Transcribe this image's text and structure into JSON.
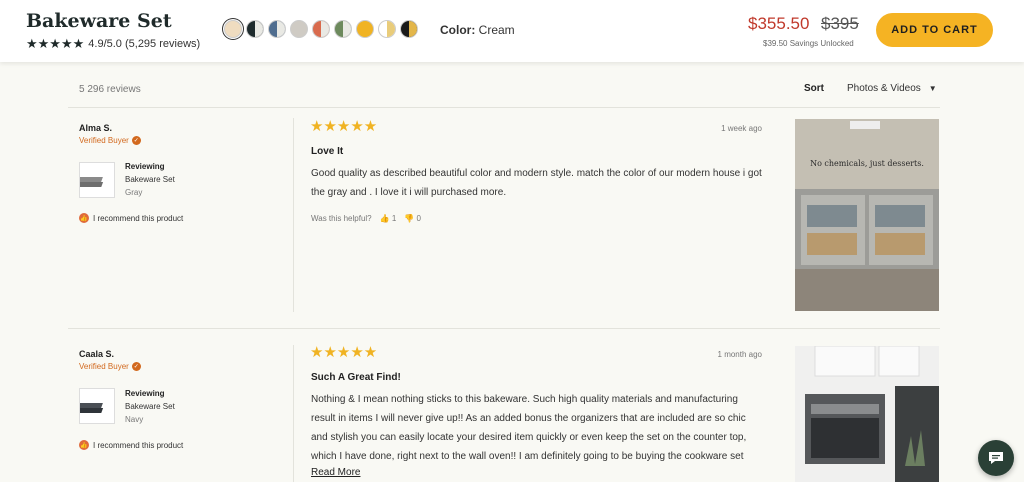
{
  "header": {
    "title": "Bakeware Set",
    "rating_text": "4.9/5.0 (5,295 reviews)",
    "stars": "★★★★★",
    "color_label": "Color:",
    "color_value": "Cream",
    "price_now": "$355.50",
    "price_was": "$395",
    "savings": "$39.50 Savings Unlocked",
    "cart_label": "ADD TO CART",
    "swatches": [
      {
        "name": "Cream",
        "color": "#efdcc0",
        "half": ""
      },
      {
        "name": "Navy-Black",
        "color": "#1e2b2d",
        "half": "#e9e9e4"
      },
      {
        "name": "Blue",
        "color": "#4f6d8f",
        "half": "#e9e9e4"
      },
      {
        "name": "Gray",
        "color": "#cfcbc4",
        "half": ""
      },
      {
        "name": "Terracotta",
        "color": "#d96b4e",
        "half": "#e9e9e4"
      },
      {
        "name": "Sage",
        "color": "#6d8a5d",
        "half": "#e9e9e4"
      },
      {
        "name": "Mustard",
        "color": "#f0b323",
        "half": ""
      },
      {
        "name": "White-Gold",
        "color": "#ffffff",
        "half": "#e9cc7a"
      },
      {
        "name": "Black-Gold",
        "color": "#1a1a1a",
        "half": "#e3b64a"
      }
    ]
  },
  "toolbar": {
    "review_count": "5 296 reviews",
    "sort_label": "Sort",
    "sort_value": "Photos & Videos"
  },
  "reviews": [
    {
      "name": "Alma S.",
      "verified": "Verified Buyer",
      "reviewing_head": "Reviewing",
      "product": "Bakeware Set",
      "variant": "Gray",
      "recommend": "I recommend this product",
      "stars": "★★★★★",
      "date": "1 week ago",
      "title": "Love It",
      "body": "Good quality as described beautiful color and modern style. match the color of our modern house i got the gray and . I love it i will purchased more.",
      "helpful_label": "Was this helpful?",
      "up": "1",
      "down": "0",
      "photo_caption": "No chemicals, just desserts."
    },
    {
      "name": "Caala S.",
      "verified": "Verified Buyer",
      "reviewing_head": "Reviewing",
      "product": "Bakeware Set",
      "variant": "Navy",
      "recommend": "I recommend this product",
      "stars": "★★★★★",
      "date": "1 month ago",
      "title": "Such A Great Find!",
      "body": "Nothing & I mean nothing sticks to this bakeware. Such high quality materials and manufacturing result in items I will never give up!! As an added bonus the organizers that are included are so chic and stylish you can easily locate your desired item quickly or even keep the set on the counter top, which I have done, right next to the wall oven!! I am definitely going to be buying the cookware set",
      "read_more": "Read More"
    }
  ]
}
